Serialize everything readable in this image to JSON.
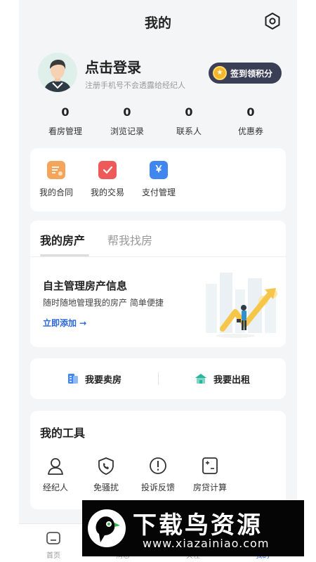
{
  "header": {
    "title": "我的"
  },
  "profile": {
    "login_title": "点击登录",
    "login_subtitle": "注册手机号不会透露给经纪人",
    "checkin_label": "签到领积分",
    "coin_glyph": "★"
  },
  "stats": [
    {
      "value": "0",
      "label": "看房管理"
    },
    {
      "value": "0",
      "label": "浏览记录"
    },
    {
      "value": "0",
      "label": "联系人"
    },
    {
      "value": "0",
      "label": "优惠券"
    }
  ],
  "quick_actions": [
    {
      "label": "我的合同",
      "icon": "contract-icon",
      "color": "#f5a45b"
    },
    {
      "label": "我的交易",
      "icon": "trade-icon",
      "color": "#ee5a5a"
    },
    {
      "label": "支付管理",
      "icon": "payment-icon",
      "color": "#3f86ef",
      "glyph": "￥"
    }
  ],
  "property": {
    "tabs": [
      "我的房产",
      "帮我找房"
    ],
    "active_tab": 0,
    "title": "自主管理房产信息",
    "description": "随时随地管理我的房产 简单便捷",
    "link": "立即添加 →"
  },
  "sell_rent": {
    "sell_label": "我要卖房",
    "rent_label": "我要出租"
  },
  "tools": {
    "title": "我的工具",
    "items": [
      {
        "label": "经纪人",
        "icon": "agent-icon"
      },
      {
        "label": "免骚扰",
        "icon": "no-disturb-icon"
      },
      {
        "label": "投诉反馈",
        "icon": "feedback-icon"
      },
      {
        "label": "房贷计算",
        "icon": "calculator-icon"
      }
    ]
  },
  "bottom_nav": [
    {
      "label": "首页",
      "icon": "home-icon"
    },
    {
      "label": "消息",
      "icon": "message-icon"
    },
    {
      "label": "关注",
      "icon": "follow-icon"
    },
    {
      "label": "我的",
      "icon": "profile-icon",
      "active": true
    }
  ],
  "watermark": {
    "title": "下载鸟资源",
    "url": "www.xiazainiao.com"
  },
  "colors": {
    "accent": "#2a65d9",
    "background": "#f4f5f7",
    "checkin_bg": "#3b3f56",
    "coin": "#f5b72a"
  }
}
